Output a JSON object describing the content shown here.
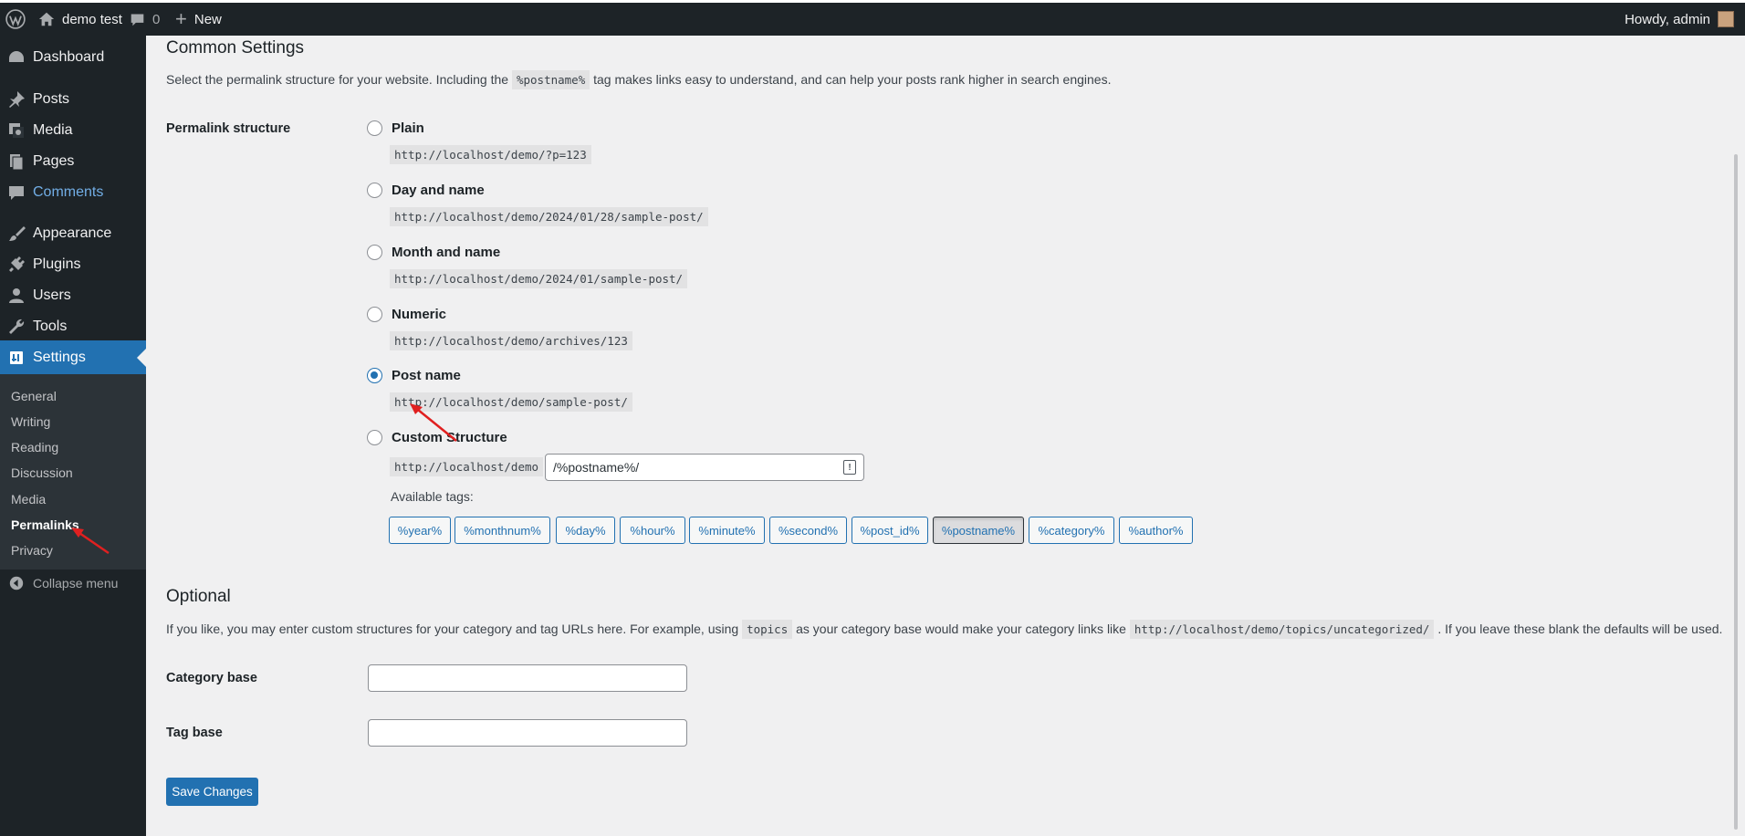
{
  "adminbar": {
    "site_name": "demo test",
    "comment_count": "0",
    "new_label": "New",
    "greeting": "Howdy, admin"
  },
  "sidebar": {
    "items": [
      {
        "label": "Dashboard",
        "icon": "dashboard-icon"
      },
      {
        "label": "Posts",
        "icon": "pin-icon"
      },
      {
        "label": "Media",
        "icon": "media-icon"
      },
      {
        "label": "Pages",
        "icon": "pages-icon"
      },
      {
        "label": "Comments",
        "icon": "comment-icon"
      },
      {
        "label": "Appearance",
        "icon": "brush-icon"
      },
      {
        "label": "Plugins",
        "icon": "plug-icon"
      },
      {
        "label": "Users",
        "icon": "user-icon"
      },
      {
        "label": "Tools",
        "icon": "wrench-icon"
      },
      {
        "label": "Settings",
        "icon": "settings-icon"
      }
    ],
    "submenu": [
      "General",
      "Writing",
      "Reading",
      "Discussion",
      "Media",
      "Permalinks",
      "Privacy"
    ],
    "collapse_label": "Collapse menu"
  },
  "common": {
    "heading": "Common Settings",
    "desc_before": "Select the permalink structure for your website. Including the",
    "desc_code": "%postname%",
    "desc_after": "tag makes links easy to understand, and can help your posts rank higher in search engines.",
    "structure_label": "Permalink structure",
    "options": [
      {
        "label": "Plain",
        "url": "http://localhost/demo/?p=123",
        "checked": false
      },
      {
        "label": "Day and name",
        "url": "http://localhost/demo/2024/01/28/sample-post/",
        "checked": false
      },
      {
        "label": "Month and name",
        "url": "http://localhost/demo/2024/01/sample-post/",
        "checked": false
      },
      {
        "label": "Numeric",
        "url": "http://localhost/demo/archives/123",
        "checked": false
      },
      {
        "label": "Post name",
        "url": "http://localhost/demo/sample-post/",
        "checked": true
      },
      {
        "label": "Custom Structure",
        "url": "",
        "checked": false
      }
    ],
    "custom_prefix": "http://localhost/demo",
    "custom_value": "/%postname%/",
    "available_tags_label": "Available tags:",
    "tags": [
      "%year%",
      "%monthnum%",
      "%day%",
      "%hour%",
      "%minute%",
      "%second%",
      "%post_id%",
      "%postname%",
      "%category%",
      "%author%"
    ],
    "active_tag": "%postname%"
  },
  "optional": {
    "heading": "Optional",
    "desc_before": "If you like, you may enter custom structures for your category and tag URLs here. For example, using",
    "desc_code1": "topics",
    "desc_mid": "as your category base would make your category links like",
    "desc_code2": "http://localhost/demo/topics/uncategorized/",
    "desc_after": ". If you leave these blank the defaults will be used.",
    "category_label": "Category base",
    "category_value": "",
    "tag_label": "Tag base",
    "tag_value": ""
  },
  "save_label": "Save Changes",
  "colors": {
    "accent": "#2271b1",
    "sidebar_bg": "#1d2327",
    "annotation_arrow": "#e02020"
  }
}
